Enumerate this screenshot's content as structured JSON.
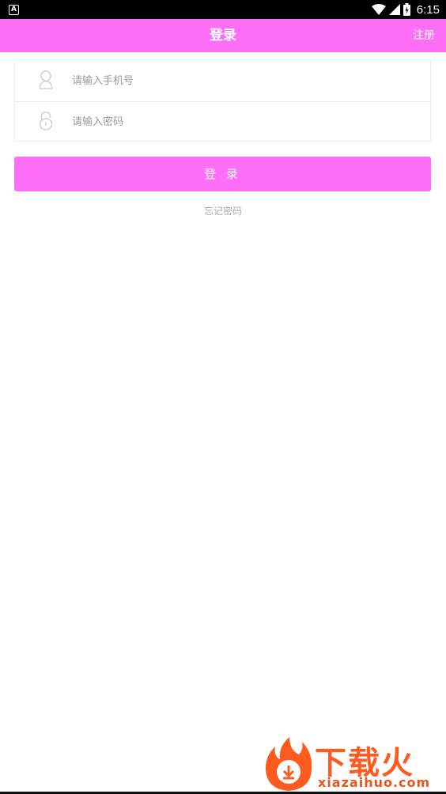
{
  "status_bar": {
    "time": "6:15",
    "left_indicator": "A"
  },
  "header": {
    "title": "登录",
    "register_label": "注册"
  },
  "form": {
    "phone_placeholder": "请输入手机号",
    "password_placeholder": "请输入密码"
  },
  "login_button": "登 录",
  "forgot_password": "忘记密码",
  "watermark": {
    "brand": "下载火",
    "url": "xiazaihuo.com"
  },
  "colors": {
    "primary": "#ff6ef7",
    "placeholder": "#9a9a9a",
    "link_gray": "#aaaaaa"
  }
}
